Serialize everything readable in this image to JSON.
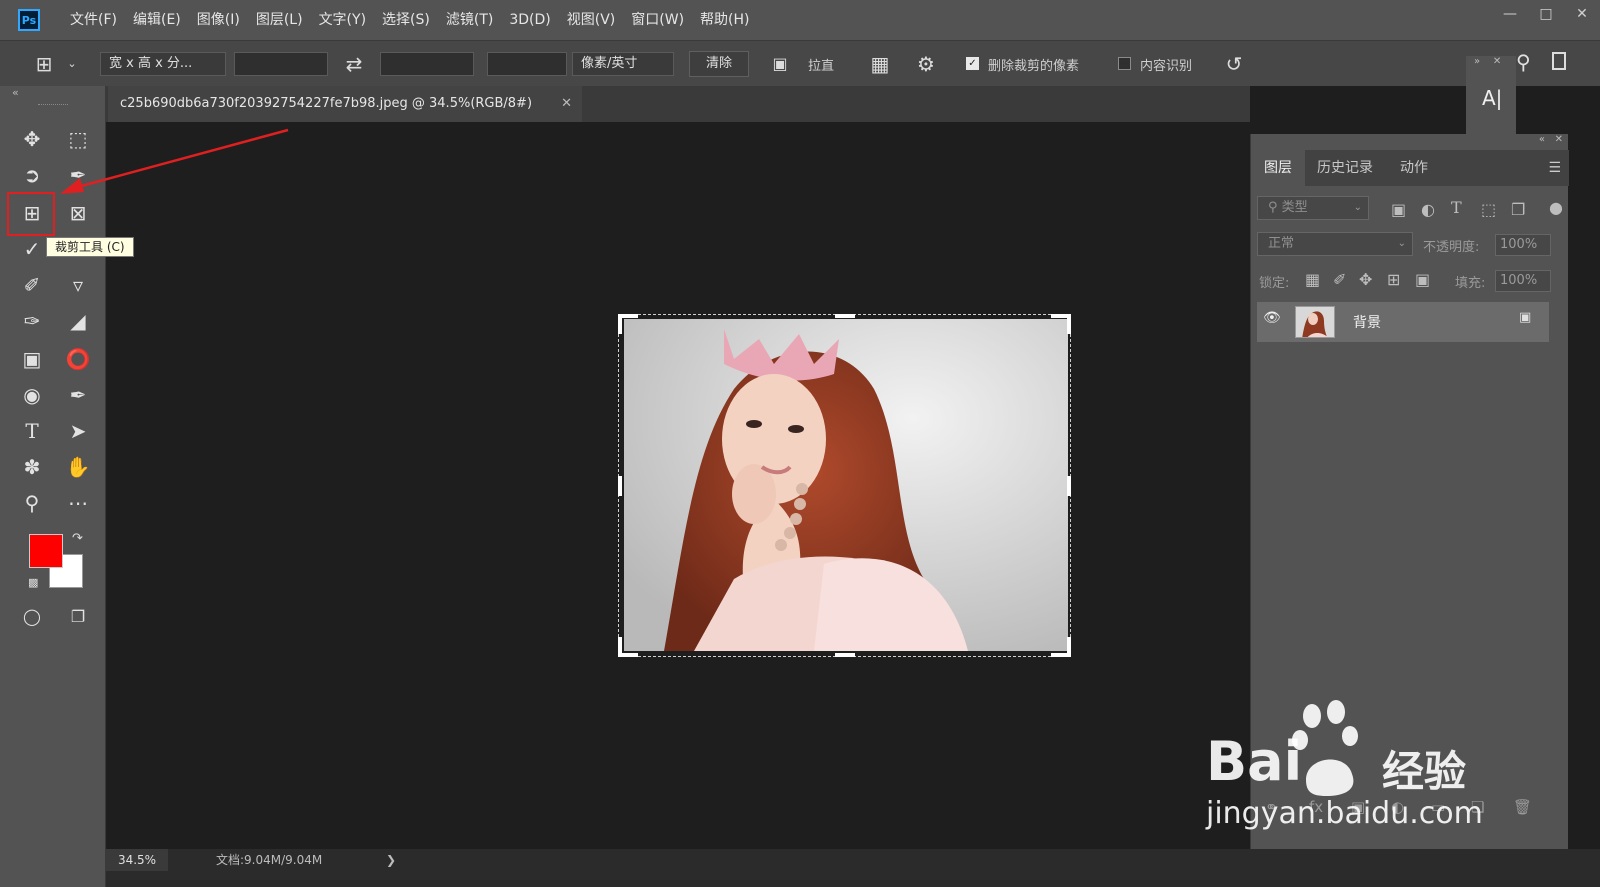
{
  "app": {
    "logo_text": "Ps"
  },
  "menu": [
    "文件(F)",
    "编辑(E)",
    "图像(I)",
    "图层(L)",
    "文字(Y)",
    "选择(S)",
    "滤镜(T)",
    "3D(D)",
    "视图(V)",
    "窗口(W)",
    "帮助(H)"
  ],
  "options": {
    "ratio_select": "宽 x 高 x 分...",
    "width_value": "",
    "height_value": "",
    "resolution_value": "",
    "unit_select": "像素/英寸",
    "clear_label": "清除",
    "straighten_label": "拉直",
    "delete_cropped_label": "删除裁剪的像素",
    "delete_cropped_checked": true,
    "content_aware_label": "内容识别",
    "content_aware_checked": false
  },
  "toolbar": {
    "tooltip": "裁剪工具 (C)",
    "foreground_color": "#ff0000",
    "background_color": "#ffffff"
  },
  "document": {
    "tab_title": "c25b690db6a730f20392754227fe7b98.jpeg @ 34.5%(RGB/8#)",
    "zoom": "34.5%",
    "doc_size": "文档:9.04M/9.04M"
  },
  "layers_panel": {
    "tabs": [
      "图层",
      "历史记录",
      "动作"
    ],
    "filter_placeholder": "类型",
    "blend_mode": "正常",
    "opacity_label": "不透明度:",
    "opacity_value": "100%",
    "lock_label": "锁定:",
    "fill_label": "填充:",
    "fill_value": "100%",
    "layer_name": "背景"
  },
  "watermark": {
    "brand_prefix": "Bai",
    "brand_suffix": "经验",
    "url": "jingyan.baidu.com"
  }
}
